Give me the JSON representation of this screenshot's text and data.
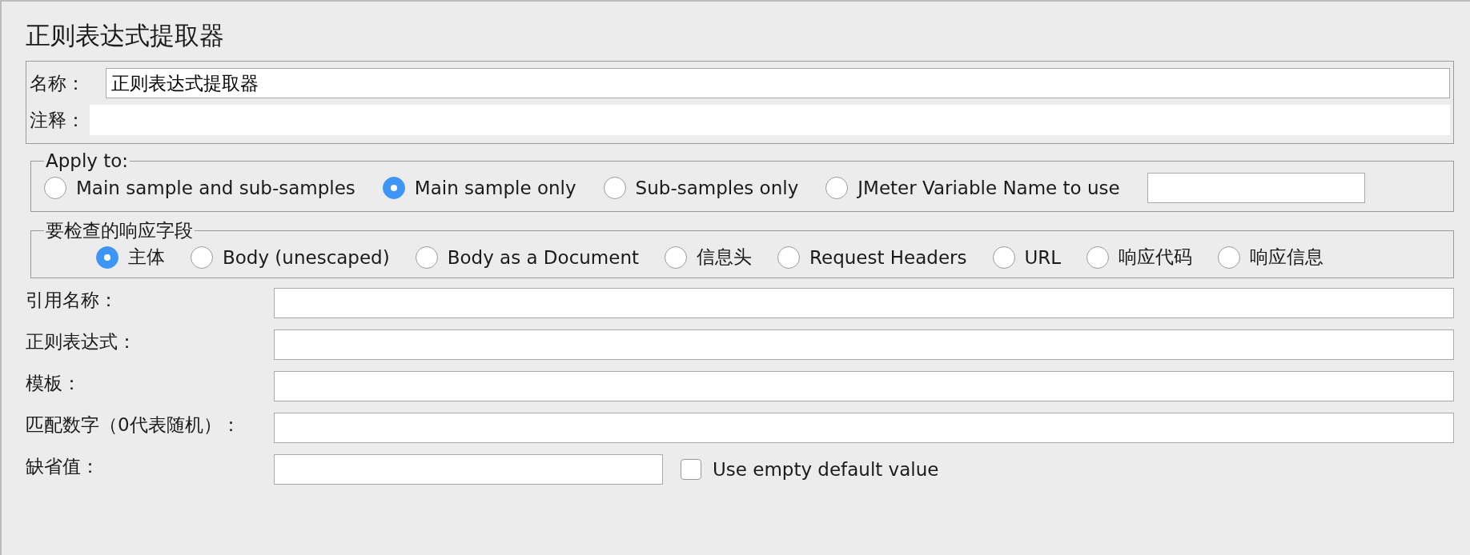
{
  "title": "正则表达式提取器",
  "name": {
    "label": "名称：",
    "value": "正则表达式提取器"
  },
  "comment": {
    "label": "注释："
  },
  "apply_to": {
    "legend": "Apply to:",
    "options": [
      {
        "label": "Main sample and sub-samples",
        "selected": false
      },
      {
        "label": "Main sample only",
        "selected": true
      },
      {
        "label": "Sub-samples only",
        "selected": false
      },
      {
        "label": "JMeter Variable Name to use",
        "selected": false
      }
    ]
  },
  "response_field": {
    "legend": "要检查的响应字段",
    "options": [
      {
        "label": "主体",
        "selected": true
      },
      {
        "label": "Body (unescaped)",
        "selected": false
      },
      {
        "label": "Body as a Document",
        "selected": false
      },
      {
        "label": "信息头",
        "selected": false
      },
      {
        "label": "Request Headers",
        "selected": false
      },
      {
        "label": "URL",
        "selected": false
      },
      {
        "label": "响应代码",
        "selected": false
      },
      {
        "label": "响应信息",
        "selected": false
      }
    ]
  },
  "fields": [
    {
      "label": "引用名称："
    },
    {
      "label": "正则表达式："
    },
    {
      "label": "模板："
    },
    {
      "label": "匹配数字（0代表随机）："
    }
  ],
  "default": {
    "label": "缺省值：",
    "checkbox": {
      "label": "Use empty default value",
      "checked": false
    }
  }
}
